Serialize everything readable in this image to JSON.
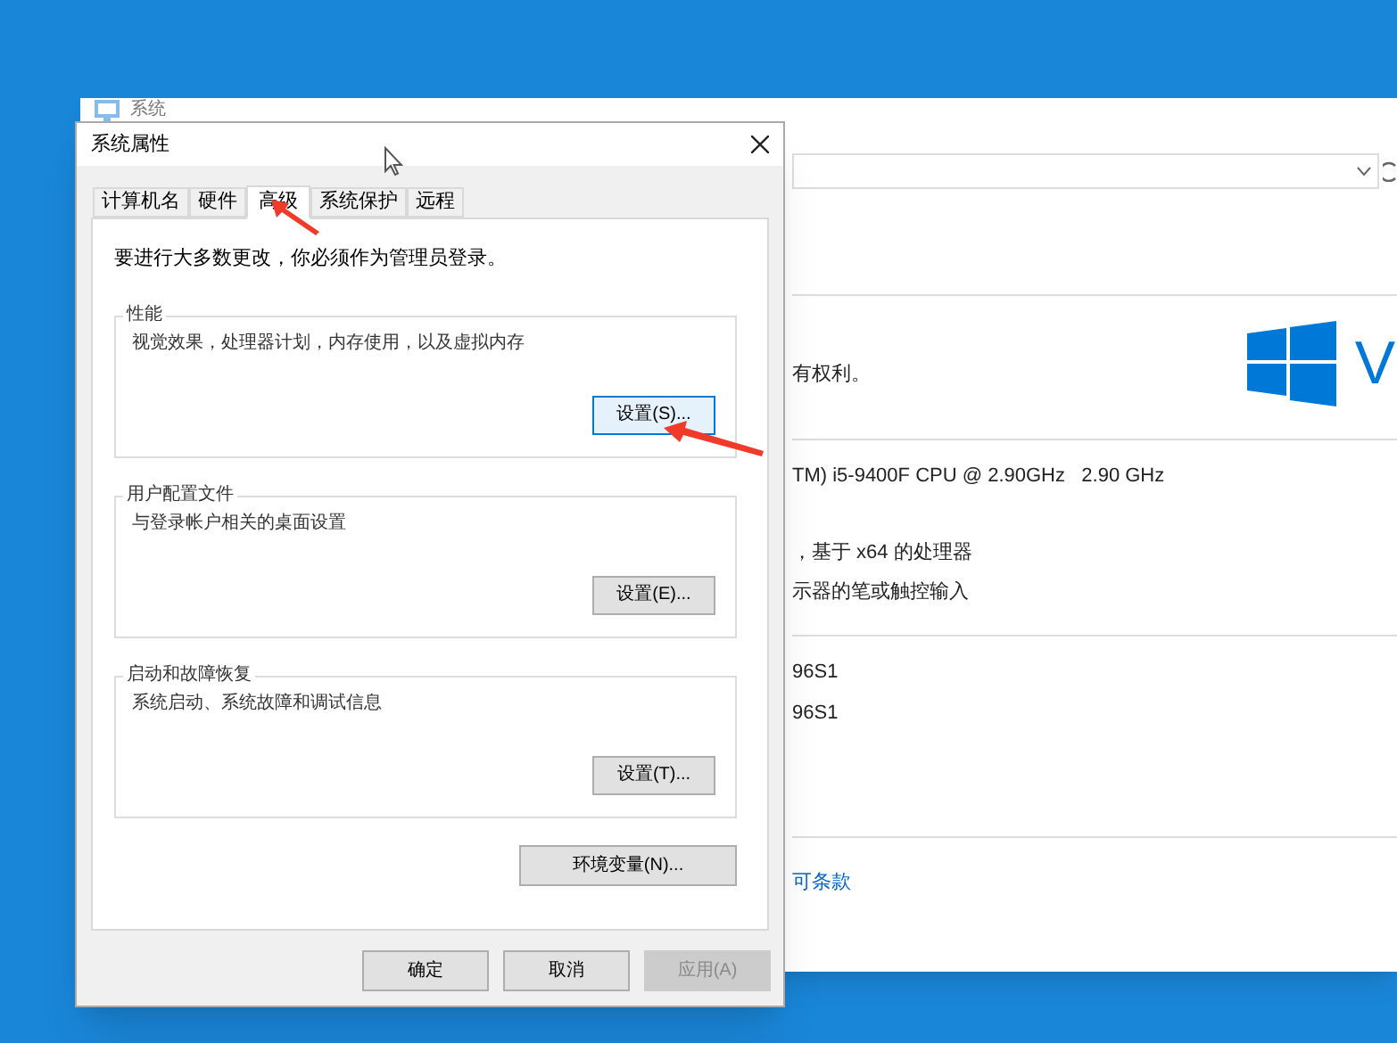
{
  "background_window": {
    "title": "系统",
    "copyright": "有权利。",
    "windows_wordmark": "V",
    "processor": "TM) i5-9400F CPU @ 2.90GHz   2.90 GHz",
    "system_type": "，基于 x64 的处理器",
    "pen_touch": "示器的笔或触控输入",
    "name_lines": [
      "96S1",
      "96S1"
    ],
    "license_link": "可条款"
  },
  "dialog": {
    "title": "系统属性",
    "tabs": [
      {
        "label": "计算机名",
        "selected": false
      },
      {
        "label": "硬件",
        "selected": false
      },
      {
        "label": "高级",
        "selected": true
      },
      {
        "label": "系统保护",
        "selected": false
      },
      {
        "label": "远程",
        "selected": false
      }
    ],
    "notice": "要进行大多数更改，你必须作为管理员登录。",
    "groups": [
      {
        "title": "性能",
        "description": "视觉效果，处理器计划，内存使用，以及虚拟内存",
        "button": "设置(S)...",
        "focused": true
      },
      {
        "title": "用户配置文件",
        "description": "与登录帐户相关的桌面设置",
        "button": "设置(E)...",
        "focused": false
      },
      {
        "title": "启动和故障恢复",
        "description": "系统启动、系统故障和调试信息",
        "button": "设置(T)...",
        "focused": false
      }
    ],
    "env_button": "环境变量(N)...",
    "buttons": [
      {
        "label": "确定",
        "disabled": false
      },
      {
        "label": "取消",
        "disabled": false
      },
      {
        "label": "应用(A)",
        "disabled": true
      }
    ]
  }
}
